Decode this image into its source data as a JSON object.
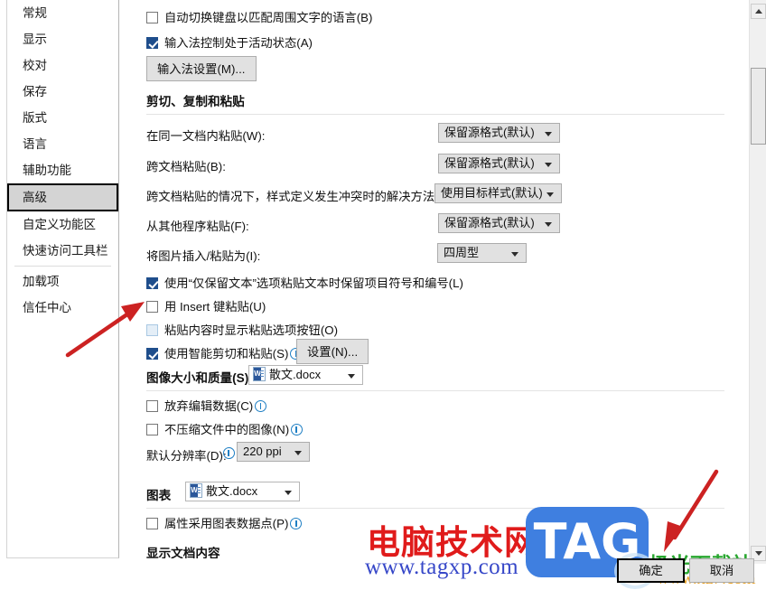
{
  "sidebar": {
    "items": [
      {
        "label": "常规",
        "selected": false
      },
      {
        "label": "显示",
        "selected": false
      },
      {
        "label": "校对",
        "selected": false
      },
      {
        "label": "保存",
        "selected": false
      },
      {
        "label": "版式",
        "selected": false
      },
      {
        "label": "语言",
        "selected": false
      },
      {
        "label": "辅助功能",
        "selected": false
      },
      {
        "label": "高级",
        "selected": true
      },
      {
        "label": "自定义功能区",
        "selected": false
      },
      {
        "label": "快速访问工具栏",
        "selected": false
      },
      {
        "label": "加载项",
        "selected": false
      },
      {
        "label": "信任中心",
        "selected": false
      }
    ]
  },
  "main": {
    "top_checkboxes": [
      {
        "label": "自动切换键盘以匹配周围文字的语言(B)",
        "checked": false
      },
      {
        "label": "输入法控制处于活动状态(A)",
        "checked": true
      }
    ],
    "ime_button": "输入法设置(M)...",
    "section_cut_copy_paste": "剪切、复制和粘贴",
    "paste_rows": [
      {
        "label": "在同一文档内粘贴(W):",
        "value": "保留源格式(默认)"
      },
      {
        "label": "跨文档粘贴(B):",
        "value": "保留源格式(默认)"
      },
      {
        "label": "跨文档粘贴的情况下，样式定义发生冲突时的解决方法(E):",
        "value": "使用目标样式(默认)"
      },
      {
        "label": "从其他程序粘贴(F):",
        "value": "保留源格式(默认)"
      },
      {
        "label": "将图片插入/粘贴为(I):",
        "value": "四周型"
      }
    ],
    "paste_checkboxes": [
      {
        "label": "使用“仅保留文本”选项粘贴文本时保留项目符号和编号(L)",
        "checked": true,
        "hover": false
      },
      {
        "label": "用 Insert 键粘贴(U)",
        "checked": false,
        "hover": false
      },
      {
        "label": "粘贴内容时显示粘贴选项按钮(O)",
        "checked": false,
        "hover": true
      },
      {
        "label": "使用智能剪切和粘贴(S)",
        "checked": true,
        "hover": false,
        "info": true
      }
    ],
    "settings_button": "设置(N)...",
    "section_image_size": "图像大小和质量(S)",
    "image_file": "散文.docx",
    "image_checkboxes": [
      {
        "label": "放弃编辑数据(C)",
        "checked": false,
        "info": true
      },
      {
        "label": "不压缩文件中的图像(N)",
        "checked": false,
        "info": true
      }
    ],
    "resolution_label": "默认分辨率(D):",
    "resolution_value": "220 ppi",
    "section_chart": "图表",
    "chart_file": "散文.docx",
    "chart_checkbox": {
      "label": "属性采用图表数据点(P)",
      "checked": false,
      "info": true
    },
    "section_show_doc_content": "显示文档内容"
  },
  "footer": {
    "ok_label": "确定",
    "cancel_label": "取消"
  },
  "watermark": {
    "cn_text": "电脑技术网",
    "url_text": "www.tagxp.com",
    "tag_text": "TAG",
    "jg_text": "极光下载站",
    "xz_text": "www.xz7.com"
  },
  "colors": {
    "accent_checkbox": "#1f4e8c",
    "selection_bg": "#d4d4d4",
    "arrow_red": "#cc2222",
    "watermark_red": "#e01b1b",
    "watermark_blue": "#3647c8",
    "tag_blue": "#3f7fe0",
    "info_blue": "#1f7fc4"
  }
}
